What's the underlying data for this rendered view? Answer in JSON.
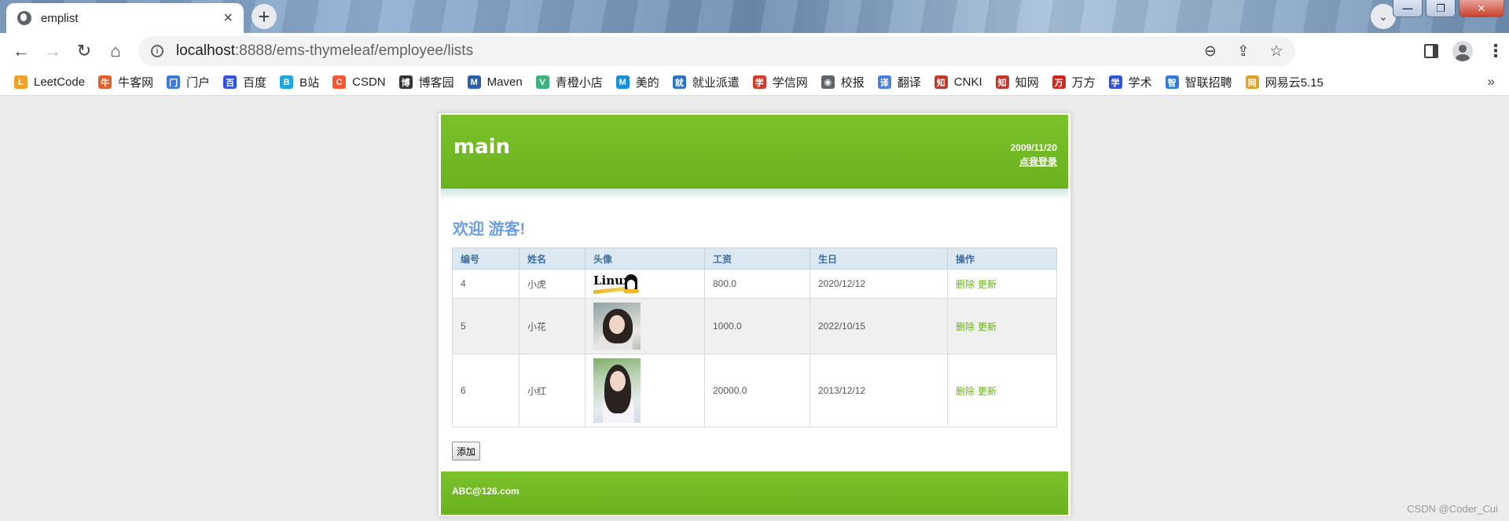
{
  "browser": {
    "tab_title": "emplist",
    "tab_close": "×",
    "new_tab": "+",
    "url_host": "localhost",
    "url_path": ":8888/ems-thymeleaf/employee/lists",
    "window_buttons": {
      "minimize": "—",
      "maximize": "❐",
      "close": "✕"
    },
    "bookmarks": [
      {
        "label": "LeetCode",
        "icon": "leetcode-icon",
        "color": "#f0a12a",
        "glyph": "L"
      },
      {
        "label": "牛客网",
        "icon": "nowcoder-icon",
        "color": "#e0602b",
        "glyph": "牛"
      },
      {
        "label": "门户",
        "icon": "portal-icon",
        "color": "#3a7bd5",
        "glyph": "门"
      },
      {
        "label": "百度",
        "icon": "baidu-icon",
        "color": "#2f52d8",
        "glyph": "百"
      },
      {
        "label": "B站",
        "icon": "bilibili-icon",
        "color": "#1fa4de",
        "glyph": "B"
      },
      {
        "label": "CSDN",
        "icon": "csdn-icon",
        "color": "#fc5531",
        "glyph": "C"
      },
      {
        "label": "博客园",
        "icon": "cnblogs-icon",
        "color": "#333333",
        "glyph": "博"
      },
      {
        "label": "Maven",
        "icon": "maven-icon",
        "color": "#2c5fa8",
        "glyph": "M"
      },
      {
        "label": "青橙小店",
        "icon": "vue-icon",
        "color": "#3fb27f",
        "glyph": "V"
      },
      {
        "label": "美的",
        "icon": "midea-icon",
        "color": "#1a8fd6",
        "glyph": "M"
      },
      {
        "label": "就业派遣",
        "icon": "graduation-icon",
        "color": "#2f6fc4",
        "glyph": "就"
      },
      {
        "label": "学信网",
        "icon": "chsi-icon",
        "color": "#d33a2c",
        "glyph": "学"
      },
      {
        "label": "校报",
        "icon": "globe-icon",
        "color": "#5f6368",
        "glyph": "◉"
      },
      {
        "label": "翻译",
        "icon": "translate-icon",
        "color": "#4a7fe0",
        "glyph": "译"
      },
      {
        "label": "CNKI",
        "icon": "cnki-icon",
        "color": "#c0392b",
        "glyph": "知"
      },
      {
        "label": "知网",
        "icon": "cnki-icon",
        "color": "#c0392b",
        "glyph": "知"
      },
      {
        "label": "万方",
        "icon": "wanfang-icon",
        "color": "#d0281f",
        "glyph": "万"
      },
      {
        "label": "学术",
        "icon": "baidu-scholar-icon",
        "color": "#2f52d8",
        "glyph": "学"
      },
      {
        "label": "智联招聘",
        "icon": "zhaopin-icon",
        "color": "#2d7be0",
        "glyph": "智"
      },
      {
        "label": "网易云5.15",
        "icon": "netease-icon",
        "color": "#e0a12b",
        "glyph": "网"
      }
    ],
    "bookmarks_more": "»"
  },
  "page": {
    "logo": "main",
    "date": "2009/11/20",
    "login_link": "点我登录",
    "welcome": "欢迎 游客!",
    "table": {
      "headers": [
        "编号",
        "姓名",
        "头像",
        "工资",
        "生日",
        "操作"
      ],
      "rows": [
        {
          "id": "4",
          "name": "小虎",
          "avatar": "linux",
          "salary": "800.0",
          "birthday": "2020/12/12",
          "delete": "删除",
          "update": "更新"
        },
        {
          "id": "5",
          "name": "小花",
          "avatar": "photo1",
          "salary": "1000.0",
          "birthday": "2022/10/15",
          "delete": "删除",
          "update": "更新"
        },
        {
          "id": "6",
          "name": "小红",
          "avatar": "photo2",
          "salary": "20000.0",
          "birthday": "2013/12/12",
          "delete": "删除",
          "update": "更新"
        }
      ]
    },
    "add_button": "添加",
    "footer_email": "ABC@126.com",
    "linux_logo_text": "Linux"
  },
  "watermark": "CSDN @Coder_Cui",
  "colors": {
    "header_green": "#7bc12a",
    "welcome_blue": "#6c9ee2",
    "link_green": "#6ab21f"
  }
}
